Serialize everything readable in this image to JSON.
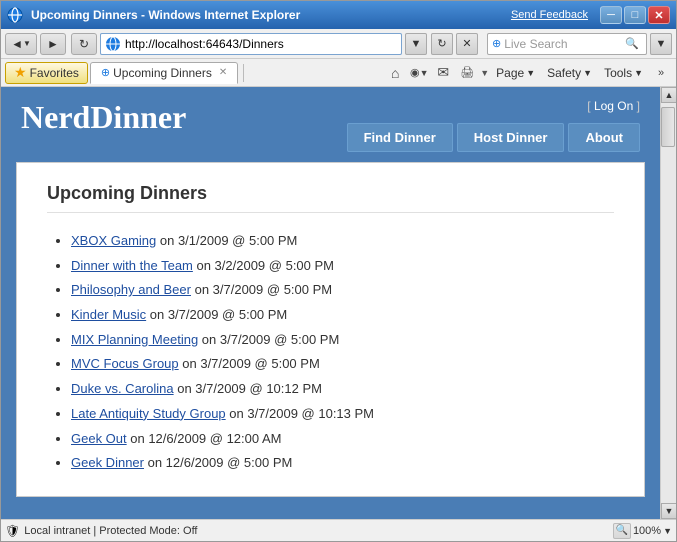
{
  "window": {
    "title": "Upcoming Dinners - Windows Internet Explorer",
    "send_feedback": "Send Feedback"
  },
  "address_bar": {
    "url": "http://localhost:64643/Dinners",
    "search_placeholder": "Live Search"
  },
  "toolbar": {
    "favorites_label": "Favorites",
    "tab_label": "Upcoming Dinners",
    "page_btn": "Page",
    "safety_btn": "Safety",
    "tools_btn": "Tools"
  },
  "site": {
    "title": "NerdDinner",
    "log_on": "Log On",
    "nav": {
      "find_dinner": "Find Dinner",
      "host_dinner": "Host Dinner",
      "about": "About"
    },
    "page_title": "Upcoming Dinners",
    "dinners": [
      {
        "name": "XBOX Gaming",
        "date": "on 3/1/2009 @ 5:00 PM"
      },
      {
        "name": "Dinner with the Team",
        "date": "on 3/2/2009 @ 5:00 PM"
      },
      {
        "name": "Philosophy and Beer",
        "date": "on 3/7/2009 @ 5:00 PM"
      },
      {
        "name": "Kinder Music",
        "date": "on 3/7/2009 @ 5:00 PM"
      },
      {
        "name": "MIX Planning Meeting",
        "date": "on 3/7/2009 @ 5:00 PM"
      },
      {
        "name": "MVC Focus Group",
        "date": "on 3/7/2009 @ 5:00 PM"
      },
      {
        "name": "Duke vs. Carolina",
        "date": "on 3/7/2009 @ 10:12 PM"
      },
      {
        "name": "Late Antiquity Study Group",
        "date": "on 3/7/2009 @ 10:13 PM"
      },
      {
        "name": "Geek Out",
        "date": "on 12/6/2009 @ 12:00 AM"
      },
      {
        "name": "Geek Dinner",
        "date": "on 12/6/2009 @ 5:00 PM"
      }
    ]
  },
  "status_bar": {
    "text": "Local intranet | Protected Mode: Off",
    "zoom": "100%"
  },
  "icons": {
    "back": "◄",
    "forward": "►",
    "refresh": "↻",
    "stop": "✕",
    "home": "⌂",
    "rss": "◉",
    "print": "🖨",
    "search": "🔍",
    "up_arrow": "▲",
    "down_arrow": "▼"
  }
}
